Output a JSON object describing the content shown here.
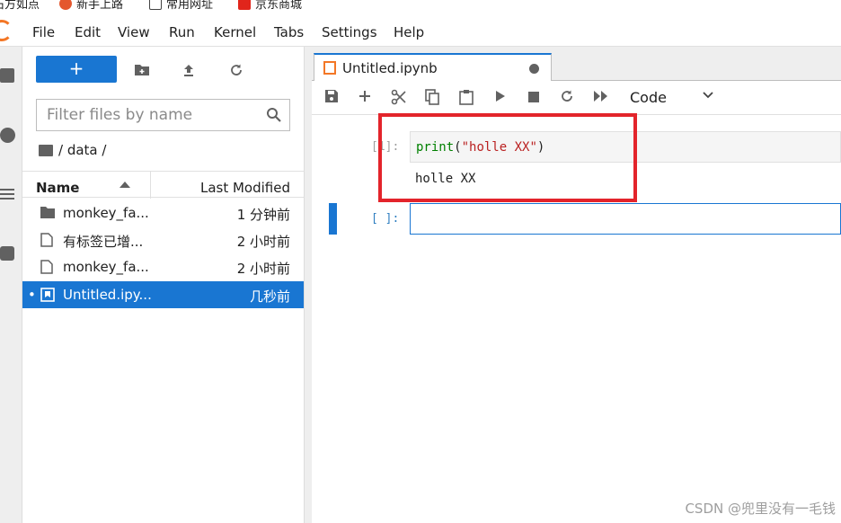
{
  "bookmarks": [
    {
      "label": "石方如点"
    },
    {
      "label": "新手上路"
    },
    {
      "label": "常用网址"
    },
    {
      "label": "京东商城"
    }
  ],
  "menu": [
    "File",
    "Edit",
    "View",
    "Run",
    "Kernel",
    "Tabs",
    "Settings",
    "Help"
  ],
  "filebrowser": {
    "new_label": "+",
    "filter_placeholder": "Filter files by name",
    "breadcrumb": "/ data /",
    "col_name": "Name",
    "col_modified": "Last Modified",
    "files": [
      {
        "name": "monkey_fa...",
        "modified": "1 分钟前",
        "kind": "folder"
      },
      {
        "name": "有标签已增...",
        "modified": "2 小时前",
        "kind": "file"
      },
      {
        "name": "monkey_fa...",
        "modified": "2 小时前",
        "kind": "file"
      },
      {
        "name": "Untitled.ipy...",
        "modified": "几秒前",
        "kind": "notebook",
        "selected": true,
        "running": "•"
      }
    ]
  },
  "notebook": {
    "tab_title": "Untitled.ipynb",
    "cell_type": "Code",
    "cells": [
      {
        "prompt": "[1]:",
        "code_func": "print",
        "code_open": "(",
        "code_str": "\"holle XX\"",
        "code_close": ")",
        "output": "holle XX"
      },
      {
        "prompt": "[ ]:"
      }
    ]
  },
  "watermark": "CSDN @兜里没有一毛钱",
  "colors": {
    "accent": "#1976d2",
    "annotation": "#e3242b",
    "logo": "#f37726"
  }
}
